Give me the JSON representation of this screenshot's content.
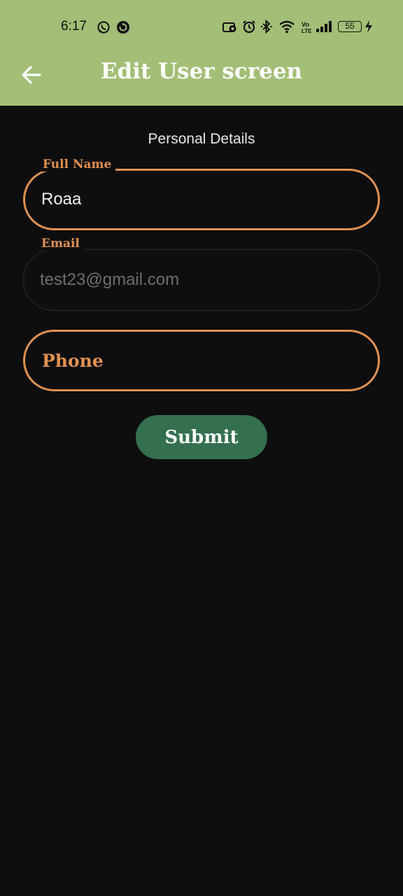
{
  "status_bar": {
    "time": "6:17",
    "battery_level": "55",
    "icons": [
      "whatsapp-icon",
      "sync-icon",
      "screen-record-icon",
      "alarm-icon",
      "bluetooth-icon",
      "wifi-icon",
      "volte-icon",
      "signal-icon",
      "battery-icon",
      "charging-icon"
    ]
  },
  "app_bar": {
    "title": "Edit User screen",
    "back_icon": "arrow-back-icon"
  },
  "form": {
    "section_title": "Personal Details",
    "full_name": {
      "label": "Full Name",
      "value": "Roaa"
    },
    "email": {
      "label": "Email",
      "value": "test23@gmail.com"
    },
    "phone": {
      "placeholder": "Phone"
    },
    "submit_label": "Submit"
  },
  "colors": {
    "app_bar": "#a3be76",
    "background": "#0e0e0f",
    "accent": "#e0914f",
    "button": "#34704f"
  }
}
